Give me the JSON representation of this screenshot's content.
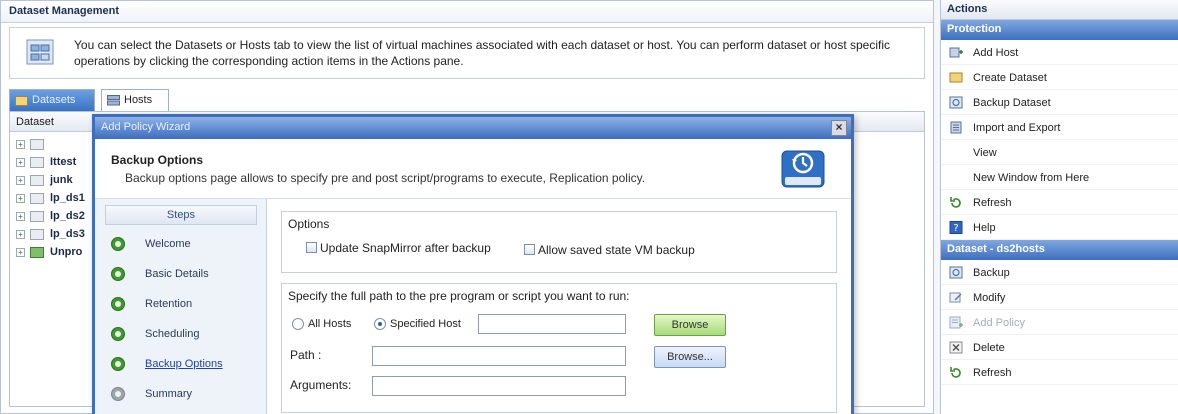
{
  "main": {
    "title": "Dataset Management",
    "info_text": "You can select the Datasets or Hosts tab to view the list of virtual machines associated with each dataset or host. You can perform dataset or host specific operations by clicking the corresponding action items in the Actions pane.",
    "tabs": [
      {
        "label": "Datasets",
        "icon": "datasets-icon"
      },
      {
        "label": "Hosts",
        "icon": "hosts-icon"
      }
    ],
    "tree_header": "Dataset",
    "tree_items": [
      "",
      "Ittest",
      "junk",
      "lp_ds1",
      "lp_ds2",
      "lp_ds3",
      "Unpro"
    ]
  },
  "wizard": {
    "title": "Add Policy Wizard",
    "header_title": "Backup Options",
    "header_desc": "Backup options page allows to specify pre and post script/programs to execute, Replication policy.",
    "steps_header": "Steps",
    "steps": [
      {
        "label": "Welcome",
        "state": "done"
      },
      {
        "label": "Basic Details",
        "state": "done"
      },
      {
        "label": "Retention",
        "state": "done"
      },
      {
        "label": "Scheduling",
        "state": "done"
      },
      {
        "label": "Backup Options",
        "state": "active"
      },
      {
        "label": "Summary",
        "state": "pending"
      }
    ],
    "options_label": "Options",
    "chk_update": "Update SnapMirror after backup",
    "chk_saved_state": "Allow saved state VM backup",
    "pre_label": "Specify the full path to the pre program or script you want to run:",
    "radio_all": "All Hosts",
    "radio_specified": "Specified Host",
    "path_label": "Path :",
    "arguments_label": "Arguments:",
    "browse_label": "Browse",
    "browse2_label": "Browse..."
  },
  "actions": {
    "header": "Actions",
    "protection_header": "Protection",
    "protection_items": [
      {
        "label": "Add Host",
        "icon": "add-host-icon"
      },
      {
        "label": "Create Dataset",
        "icon": "create-dataset-icon"
      },
      {
        "label": "Backup Dataset",
        "icon": "backup-dataset-icon"
      },
      {
        "label": "Import and Export",
        "icon": "import-export-icon"
      },
      {
        "label": "View",
        "icon": ""
      },
      {
        "label": "New Window from Here",
        "icon": ""
      },
      {
        "label": "Refresh",
        "icon": "refresh-icon"
      },
      {
        "label": "Help",
        "icon": "help-icon"
      }
    ],
    "dataset_header": "Dataset - ds2hosts",
    "dataset_items": [
      {
        "label": "Backup",
        "icon": "backup-icon",
        "disabled": false
      },
      {
        "label": "Modify",
        "icon": "modify-icon",
        "disabled": false
      },
      {
        "label": "Add Policy",
        "icon": "add-policy-icon",
        "disabled": true
      },
      {
        "label": "Delete",
        "icon": "delete-icon",
        "disabled": false
      },
      {
        "label": "Refresh",
        "icon": "refresh-icon",
        "disabled": false
      }
    ]
  },
  "colors": {
    "title_bar": "#3d6cc0",
    "section_header": "#3e6fbf",
    "step_done": "#3f9a2e",
    "browse_green": "#a6dc78"
  }
}
